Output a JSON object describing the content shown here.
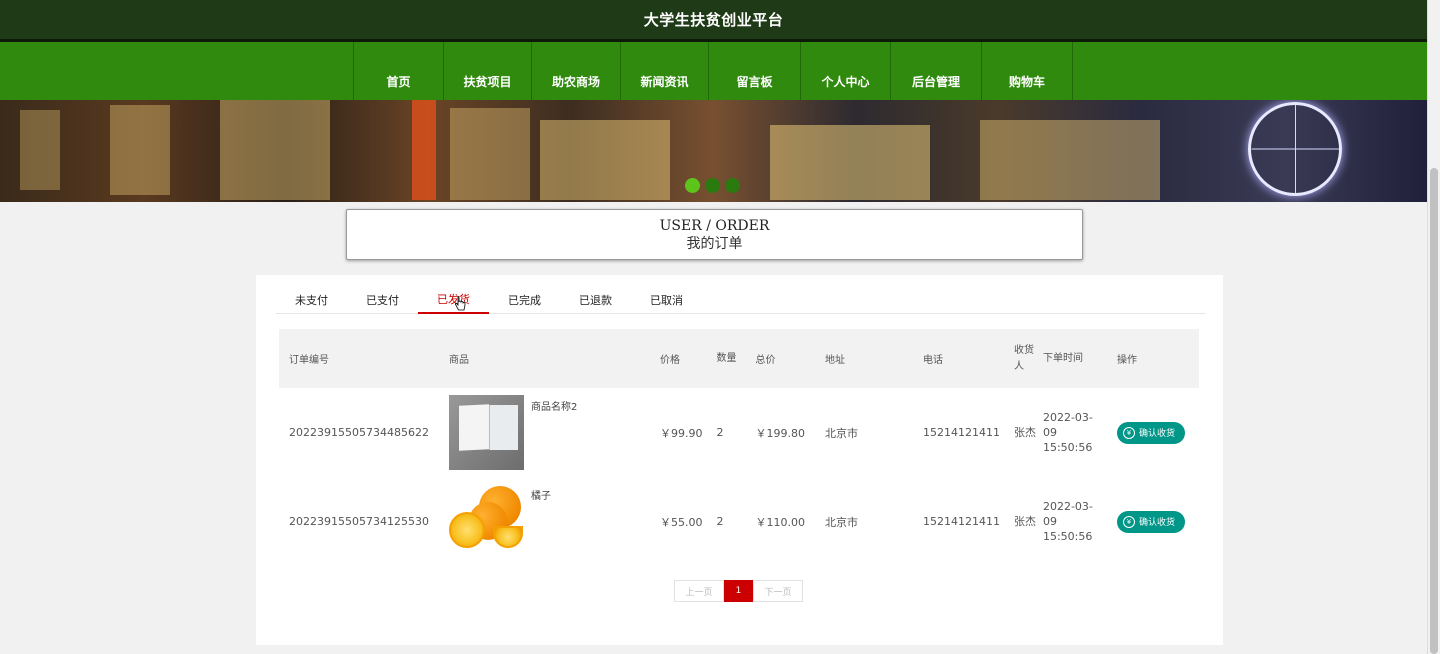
{
  "site": {
    "title": "大学生扶贫创业平台"
  },
  "nav": {
    "items": [
      {
        "label": "首页"
      },
      {
        "label": "扶贫项目"
      },
      {
        "label": "助农商场"
      },
      {
        "label": "新闻资讯"
      },
      {
        "label": "留言板"
      },
      {
        "label": "个人中心"
      },
      {
        "label": "后台管理"
      },
      {
        "label": "购物车"
      }
    ]
  },
  "heading": {
    "en": "USER / ORDER",
    "cn": "我的订单"
  },
  "tabs": [
    {
      "label": "未支付"
    },
    {
      "label": "已支付"
    },
    {
      "label": "已发货",
      "active": true
    },
    {
      "label": "已完成"
    },
    {
      "label": "已退款"
    },
    {
      "label": "已取消"
    }
  ],
  "table": {
    "headers": {
      "order_no": "订单编号",
      "product": "商品",
      "price": "价格",
      "qty": "数量",
      "total": "总价",
      "address": "地址",
      "phone": "电话",
      "receiver": "收货人",
      "time": "下单时间",
      "action": "操作"
    },
    "rows": [
      {
        "order_no": "20223915505734485622",
        "product_name": "商品名称2",
        "image": "book-image",
        "price": "￥99.90",
        "qty": "2",
        "total": "￥199.80",
        "address": "北京市",
        "phone": "15214121411",
        "receiver": "张杰",
        "time": "2022-03-09 15:50:56",
        "action_label": "确认收货"
      },
      {
        "order_no": "20223915505734125530",
        "product_name": "橘子",
        "image": "orange-image",
        "price": "￥55.00",
        "qty": "2",
        "total": "￥110.00",
        "address": "北京市",
        "phone": "15214121411",
        "receiver": "张杰",
        "time": "2022-03-09 15:50:56",
        "action_label": "确认收货"
      }
    ]
  },
  "pager": {
    "prev": "上一页",
    "current": "1",
    "next": "下一页"
  },
  "colors": {
    "topbar": "#1e3a16",
    "nav": "#2f8a0e",
    "accent": "#c00000",
    "confirm": "#009688"
  },
  "icons": {
    "confirm": "yen-icon"
  }
}
